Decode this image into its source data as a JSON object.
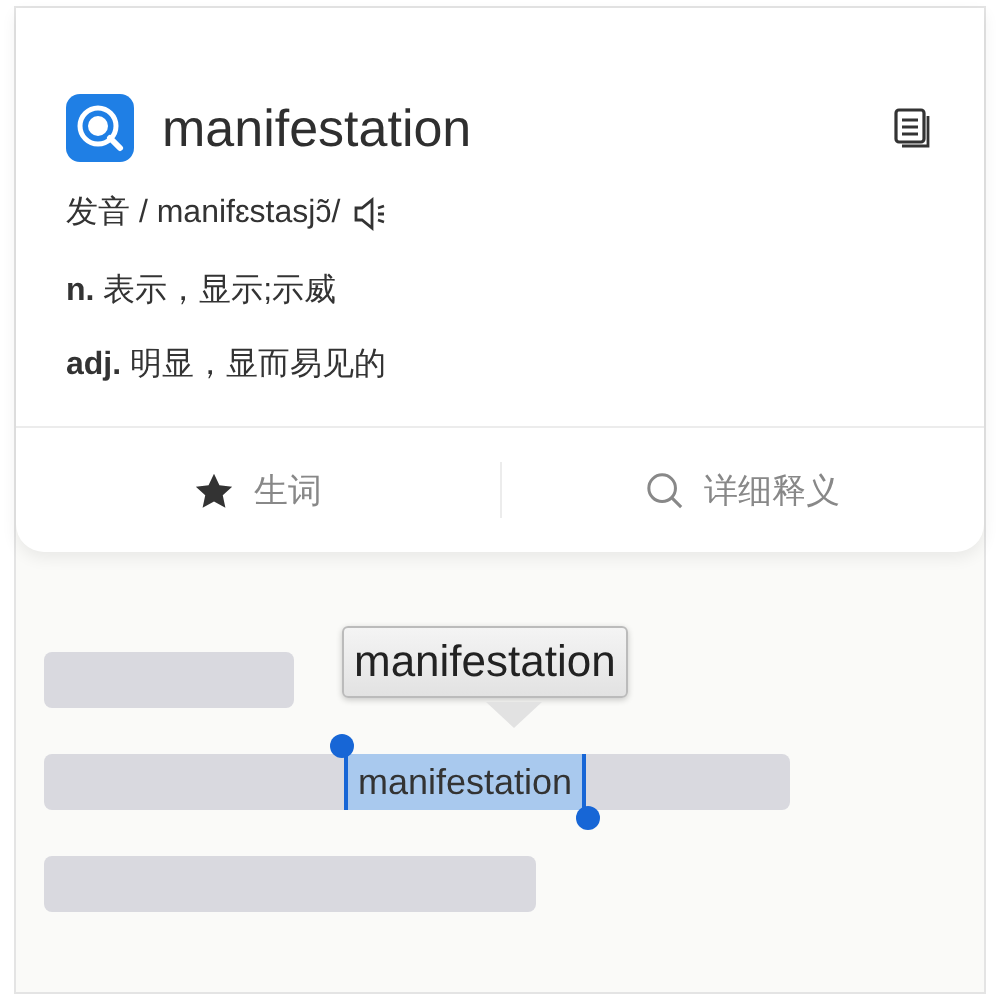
{
  "entry": {
    "word": "manifestation",
    "pronunciation": "发音 / manifɛstasjɔ̃/",
    "definitions": [
      "**n.** 表示，显示;示威",
      "**adj.** 明显，显而易见的"
    ]
  },
  "actions": [
    {
      "kind": "star",
      "label": "生词"
    },
    {
      "kind": "search",
      "label": "详细释义"
    }
  ],
  "selection": {
    "text": "manifestation",
    "tooltip": "manifestation"
  }
}
